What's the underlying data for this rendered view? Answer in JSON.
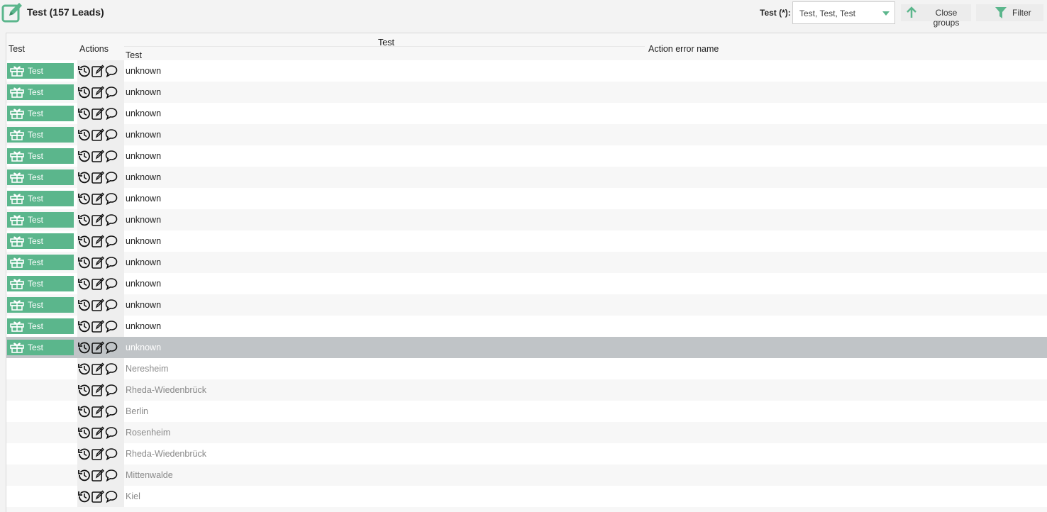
{
  "header": {
    "title": "Test (157 Leads)",
    "select_label": "Test (*):",
    "select_value": "Test, Test, Test",
    "close_groups_label": "Close groups",
    "filter_label": "Filter"
  },
  "table": {
    "columns": {
      "col1": "Test",
      "actions": "Actions",
      "group": "Test",
      "group_sub": "Test",
      "error": "Action error name"
    },
    "rows": [
      {
        "badge": "Test",
        "value": "unknown"
      },
      {
        "badge": "Test",
        "value": "unknown"
      },
      {
        "badge": "Test",
        "value": "unknown"
      },
      {
        "badge": "Test",
        "value": "unknown"
      },
      {
        "badge": "Test",
        "value": "unknown"
      },
      {
        "badge": "Test",
        "value": "unknown"
      },
      {
        "badge": "Test",
        "value": "unknown"
      },
      {
        "badge": "Test",
        "value": "unknown"
      },
      {
        "badge": "Test",
        "value": "unknown"
      },
      {
        "badge": "Test",
        "value": "unknown"
      },
      {
        "badge": "Test",
        "value": "unknown"
      },
      {
        "badge": "Test",
        "value": "unknown"
      },
      {
        "badge": "Test",
        "value": "unknown"
      },
      {
        "badge": "Test",
        "value": "unknown",
        "selected": true
      },
      {
        "badge": "",
        "value": "Neresheim"
      },
      {
        "badge": "",
        "value": "Rheda-Wiedenbrück"
      },
      {
        "badge": "",
        "value": "Berlin"
      },
      {
        "badge": "",
        "value": "Rosenheim"
      },
      {
        "badge": "",
        "value": "Rheda-Wiedenbrück"
      },
      {
        "badge": "",
        "value": "Mittenwalde"
      },
      {
        "badge": "",
        "value": "Kiel"
      }
    ]
  },
  "icons": {
    "title": "edit-icon",
    "badge": "gift-icon",
    "actions": [
      "history-icon",
      "edit-icon",
      "comment-icon"
    ],
    "close_groups": "arrow-up-icon",
    "filter": "filter-icon"
  },
  "colors": {
    "accent": "#5bb68c",
    "selected_row": "#c0c4c7"
  }
}
